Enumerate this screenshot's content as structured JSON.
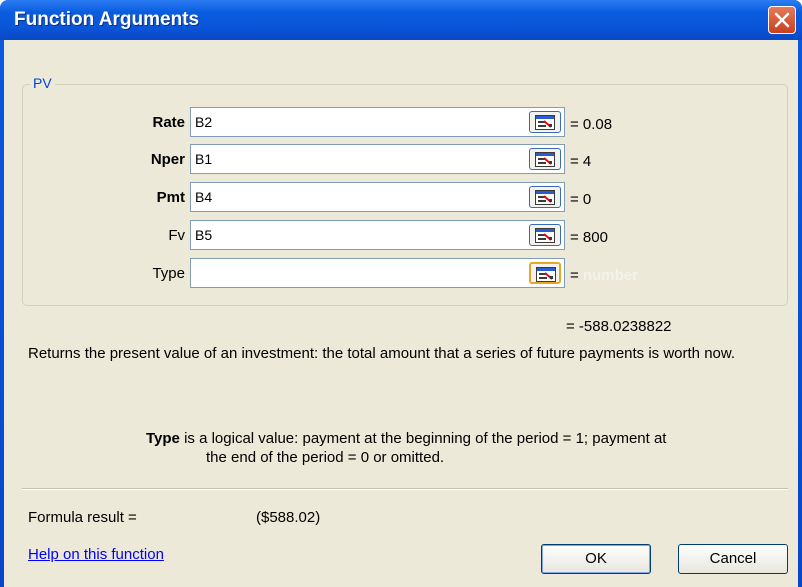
{
  "window": {
    "title": "Function Arguments"
  },
  "group": {
    "label": "PV"
  },
  "arguments": [
    {
      "label": "Rate",
      "bold": true,
      "value": "B2",
      "result": "= 0.08"
    },
    {
      "label": "Nper",
      "bold": true,
      "value": "B1",
      "result": "= 4"
    },
    {
      "label": "Pmt",
      "bold": true,
      "value": "B4",
      "result": "= 0"
    },
    {
      "label": "Fv",
      "bold": false,
      "value": "B5",
      "result": "= 800"
    },
    {
      "label": "Type",
      "bold": false,
      "value": "",
      "result_prefix": "=",
      "result_hint": "number"
    }
  ],
  "function_result": "= -588.0238822",
  "description": "Returns the present value of an investment: the total amount that a series of future payments is worth now.",
  "argument_help": {
    "name": "Type",
    "text_line1": "is a logical value: payment at the beginning of the period = 1; payment at",
    "text_line2": "the end of the period = 0 or omitted."
  },
  "formula_result": {
    "label": "Formula result =",
    "value": "($588.02)"
  },
  "help_link": "Help on this function",
  "buttons": {
    "ok": "OK",
    "cancel": "Cancel"
  },
  "colors": {
    "title_bar": "#0a5ddf",
    "dialog_bg": "#ece9d8",
    "close_button": "#c8401e",
    "group_label": "#0046d5"
  },
  "icons": {
    "close": "close-icon",
    "ref": "collapse-dialog-icon"
  }
}
